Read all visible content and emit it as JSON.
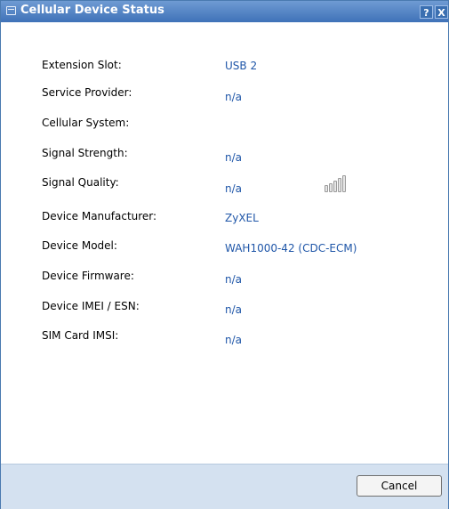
{
  "dialog": {
    "title": "Cellular Device Status",
    "help_label": "?",
    "close_label": "X"
  },
  "fields": [
    {
      "label": "Extension Slot:",
      "value": "USB 2"
    },
    {
      "label": "Service Provider:",
      "value": "n/a"
    },
    {
      "label": "Cellular System:",
      "value": ""
    },
    {
      "label": "Signal Strength:",
      "value": "n/a"
    },
    {
      "label": "Signal Quality:",
      "value": "n/a"
    },
    {
      "label": "Device Manufacturer:",
      "value": "ZyXEL"
    },
    {
      "label": "Device Model:",
      "value": "WAH1000-42 (CDC-ECM)"
    },
    {
      "label": "Device Firmware:",
      "value": "n/a"
    },
    {
      "label": "Device IMEI / ESN:",
      "value": "n/a"
    },
    {
      "label": "SIM Card IMSI:",
      "value": "n/a"
    }
  ],
  "signal_indicator": {
    "icon": "signal-bars-icon",
    "level": 0
  },
  "footer": {
    "cancel_label": "Cancel"
  },
  "colors": {
    "title_bar": "#3f72b8",
    "value_text": "#1f56a8",
    "footer": "#d4e1f0"
  }
}
